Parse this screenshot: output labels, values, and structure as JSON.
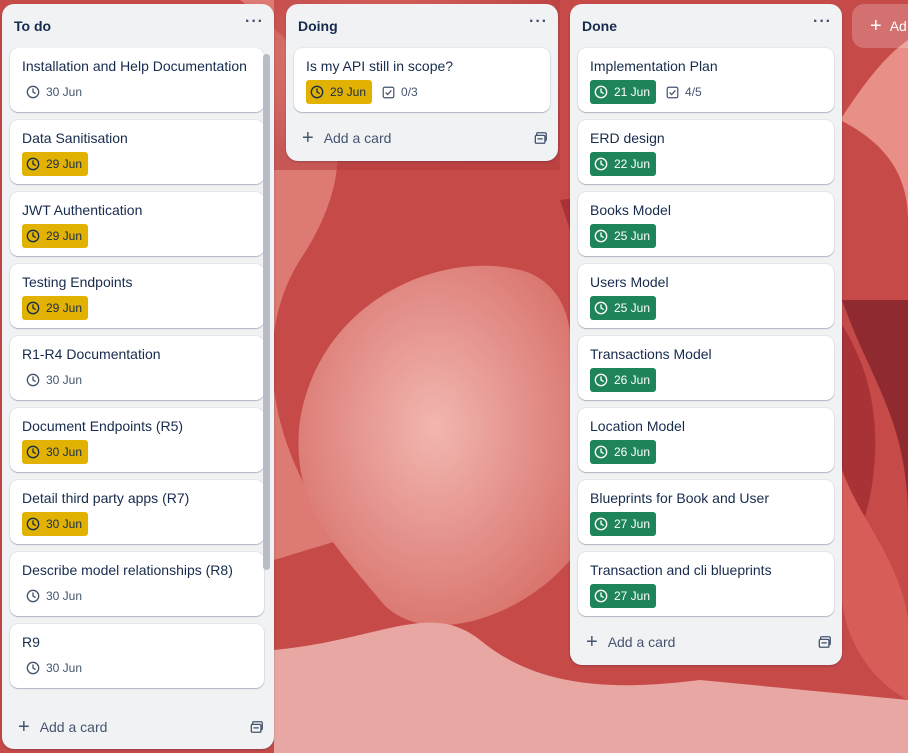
{
  "colors": {
    "background": "#c9504f",
    "list_bg": "#f1f2f4",
    "due_soon": "#e2b203",
    "complete": "#1f845a"
  },
  "add_card_label": "Add a card",
  "add_list_label": "Ad",
  "lists": [
    {
      "title": "To do",
      "cards": [
        {
          "title": "Installation and Help Documentation",
          "date": "30 Jun",
          "status": "none"
        },
        {
          "title": "Data Sanitisation",
          "date": "29 Jun",
          "status": "due-soon"
        },
        {
          "title": "JWT Authentication",
          "date": "29 Jun",
          "status": "due-soon"
        },
        {
          "title": "Testing Endpoints",
          "date": "29 Jun",
          "status": "due-soon"
        },
        {
          "title": "R1-R4 Documentation",
          "date": "30 Jun",
          "status": "none"
        },
        {
          "title": "Document Endpoints (R5)",
          "date": "30 Jun",
          "status": "due-soon"
        },
        {
          "title": "Detail third party apps (R7)",
          "date": "30 Jun",
          "status": "due-soon"
        },
        {
          "title": "Describe model relationships (R8)",
          "date": "30 Jun",
          "status": "none"
        },
        {
          "title": "R9",
          "date": "30 Jun",
          "status": "none"
        }
      ]
    },
    {
      "title": "Doing",
      "cards": [
        {
          "title": "Is my API still in scope?",
          "date": "29 Jun",
          "status": "due-soon",
          "checklist": "0/3"
        }
      ]
    },
    {
      "title": "Done",
      "cards": [
        {
          "title": "Implementation Plan",
          "date": "21 Jun",
          "status": "complete",
          "checklist": "4/5"
        },
        {
          "title": "ERD design",
          "date": "22 Jun",
          "status": "complete"
        },
        {
          "title": "Books Model",
          "date": "25 Jun",
          "status": "complete"
        },
        {
          "title": "Users Model",
          "date": "25 Jun",
          "status": "complete"
        },
        {
          "title": "Transactions Model",
          "date": "26 Jun",
          "status": "complete"
        },
        {
          "title": "Location Model",
          "date": "26 Jun",
          "status": "complete"
        },
        {
          "title": "Blueprints for Book and User",
          "date": "27 Jun",
          "status": "complete"
        },
        {
          "title": "Transaction and cli blueprints",
          "date": "27 Jun",
          "status": "complete"
        }
      ]
    }
  ]
}
